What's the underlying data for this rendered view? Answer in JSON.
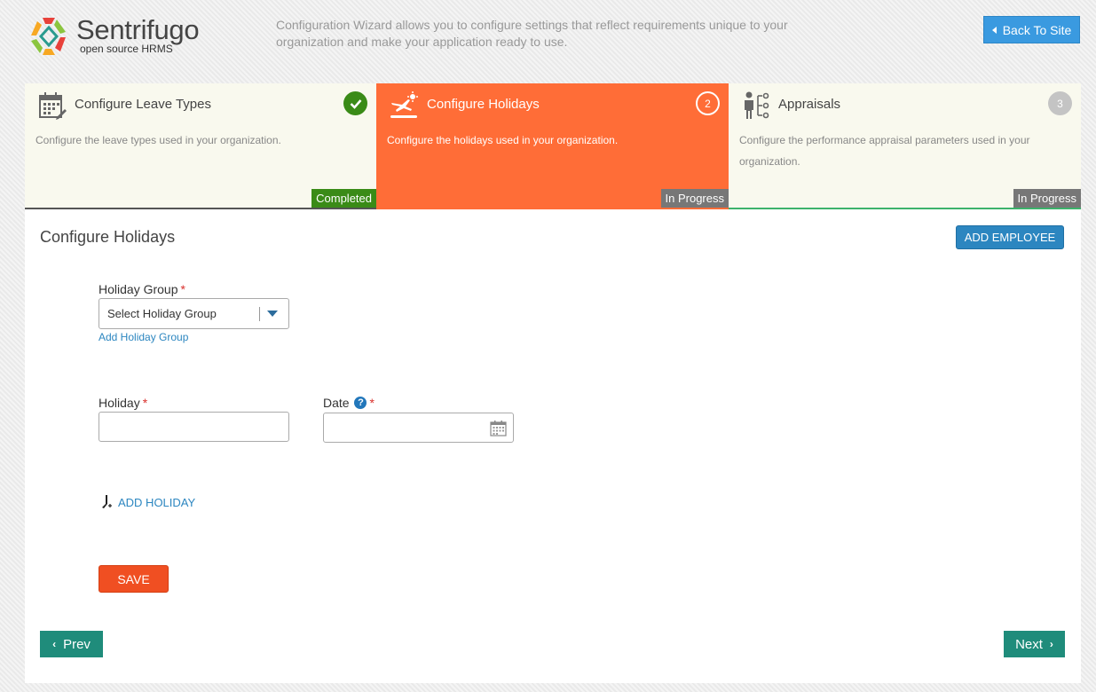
{
  "header": {
    "logo_name": "Sentrifugo",
    "logo_sub": "open source HRMS",
    "description": "Configuration Wizard allows you to configure settings that reflect requirements unique to your organization and make your application ready to use.",
    "back_label": "Back To Site"
  },
  "steps": [
    {
      "title": "Configure Leave Types",
      "desc": "Configure the leave types used in your organization.",
      "badge": "",
      "status": "Completed",
      "icon": "calendar-edit-icon"
    },
    {
      "title": "Configure Holidays",
      "desc": "Configure the holidays used in your organization.",
      "badge": "2",
      "status": "In Progress",
      "icon": "holiday-plane-icon"
    },
    {
      "title": "Appraisals",
      "desc": "Configure the performance appraisal parameters used in your organization.",
      "badge": "3",
      "status": "In Progress",
      "icon": "appraisal-people-icon"
    }
  ],
  "main": {
    "title": "Configure Holidays",
    "add_employee_label": "ADD EMPLOYEE",
    "holiday_group": {
      "label": "Holiday Group",
      "required_mark": "*",
      "value": "Select Holiday Group",
      "add_link": "Add Holiday Group"
    },
    "holiday": {
      "label": "Holiday",
      "required_mark": "*",
      "value": ""
    },
    "date": {
      "label": "Date",
      "required_mark": "*",
      "help": "?",
      "value": ""
    },
    "add_holiday_label": "ADD HOLIDAY",
    "save_label": "SAVE",
    "prev_label": "Prev",
    "next_label": "Next"
  },
  "colors": {
    "active_step": "#ff6d37",
    "completed": "#3a8b17",
    "in_progress": "#777777",
    "primary_blue": "#2c86c0",
    "save": "#f04f22",
    "nav": "#1f8c7b"
  }
}
